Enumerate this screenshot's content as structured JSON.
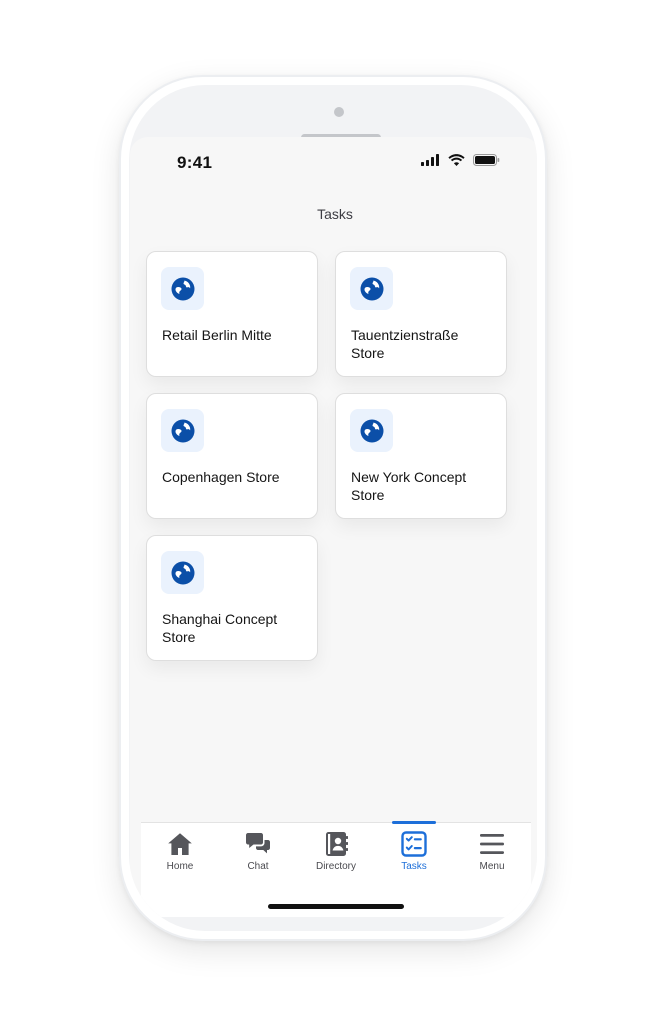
{
  "status_bar": {
    "time": "9:41"
  },
  "header": {
    "title": "Tasks"
  },
  "accent_color": "#1d6fd9",
  "icon_color": "#0b4fa8",
  "stores": [
    {
      "label": "Retail Berlin Mitte",
      "icon": "globe-icon"
    },
    {
      "label": "Tauentzienstraße Store",
      "icon": "globe-icon"
    },
    {
      "label": "Copenhagen Store",
      "icon": "globe-icon"
    },
    {
      "label": "New York Concept Store",
      "icon": "globe-icon"
    },
    {
      "label": "Shanghai Concept Store",
      "icon": "globe-icon"
    }
  ],
  "tab_bar": {
    "active": "Tasks",
    "tabs": [
      {
        "label": "Home",
        "icon": "home-icon"
      },
      {
        "label": "Chat",
        "icon": "chat-icon"
      },
      {
        "label": "Directory",
        "icon": "directory-icon"
      },
      {
        "label": "Tasks",
        "icon": "tasks-icon"
      },
      {
        "label": "Menu",
        "icon": "menu-icon"
      }
    ]
  }
}
